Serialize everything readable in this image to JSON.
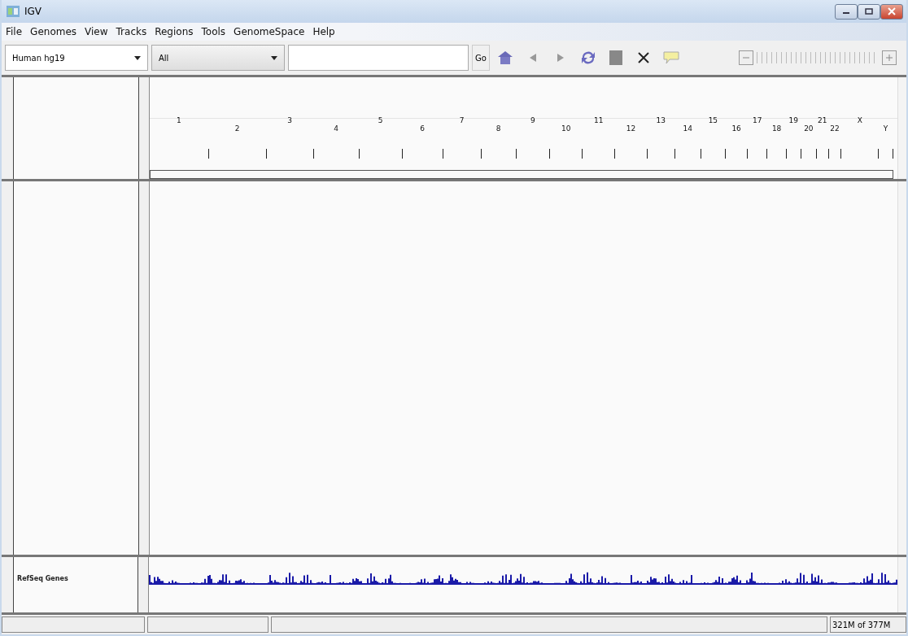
{
  "window": {
    "title": "IGV"
  },
  "menu": [
    "File",
    "Genomes",
    "View",
    "Tracks",
    "Regions",
    "Tools",
    "GenomeSpace",
    "Help"
  ],
  "toolbar": {
    "genome": "Human hg19",
    "chromosome": "All",
    "go_button": "Go"
  },
  "ruler": {
    "chromosomes": [
      "1",
      "2",
      "3",
      "4",
      "5",
      "6",
      "7",
      "8",
      "9",
      "10",
      "11",
      "12",
      "13",
      "14",
      "15",
      "16",
      "17",
      "18",
      "19",
      "20",
      "21",
      "22",
      "X",
      "Y"
    ]
  },
  "feature_track": {
    "name": "RefSeq Genes"
  },
  "status_bar": {
    "memory": "321M of 377M"
  }
}
